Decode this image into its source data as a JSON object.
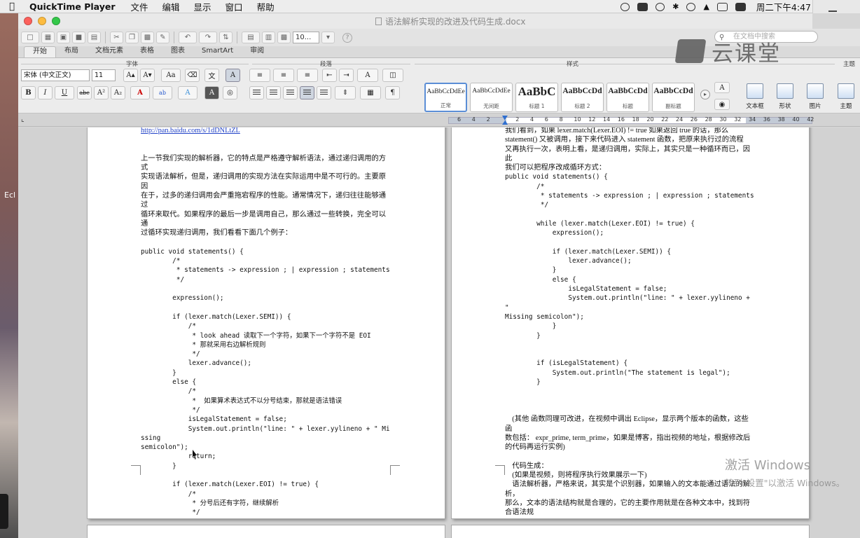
{
  "menubar": {
    "app": "QuickTime Player",
    "items": [
      "文件",
      "编辑",
      "显示",
      "窗口",
      "帮助"
    ],
    "clock": "周二下午4:47"
  },
  "window": {
    "title": "语法解析实现的改进及代码生成.docx",
    "zoom": "10...",
    "search_placeholder": "在文档中搜索"
  },
  "tabs": [
    "开始",
    "布局",
    "文档元素",
    "表格",
    "图表",
    "SmartArt",
    "审阅"
  ],
  "ribbon": {
    "groups": {
      "font": "字体",
      "paragraph": "段落",
      "styles": "样式",
      "theme": "主题"
    },
    "font_name": "宋体 (中文正文)",
    "font_size": "11",
    "styles": [
      {
        "preview": "AaBbCcDdEe",
        "name": "正常"
      },
      {
        "preview": "AaBbCcDdEe",
        "name": "无间距"
      },
      {
        "preview": "AaBbC",
        "name": "标题 1"
      },
      {
        "preview": "AaBbCcDd",
        "name": "标题 2"
      },
      {
        "preview": "AaBbCcDd",
        "name": "标题"
      },
      {
        "preview": "AaBbCcDd",
        "name": "副标题"
      }
    ],
    "buttons": {
      "textbox": "文本框",
      "shape": "形状",
      "picture": "图片",
      "theme": "主题"
    }
  },
  "ruler": {
    "numbers": [
      "6",
      "4",
      "2",
      "",
      "2",
      "4",
      "6",
      "8",
      "10",
      "12",
      "14",
      "16",
      "18",
      "20",
      "22",
      "24",
      "26",
      "28",
      "30",
      "32",
      "34",
      "36",
      "38",
      "40",
      "42"
    ]
  },
  "overlay": {
    "logo_text": "云课堂"
  },
  "watermark": {
    "line1": "激活 Windows",
    "line2": "转到\"设置\"以激活 Windows。"
  },
  "desktop": {
    "label": "Ecl"
  },
  "page1": {
    "lines": [
      "http://pan.baidu.com/s/1dDNLtZL",
      "",
      "",
      "上一节我们实现的解析器，它的特点是严格遵守解析语法，通过递归调用的方式",
      "实现语法解析，但是，递归调用的实现方法在实际运用中是不可行的。主要原因",
      "在于，过多的递归调用会严重拖宕程序的性能。通常情况下，递归往往能够通过",
      "循环来取代。如果程序的最后一步是调用自己，那么通过一些转换，完全可以通",
      "过循环实现递归调用，我们看看下面几个例子：",
      "",
      "public void statements() {",
      "        /*",
      "         * statements -> expression ; | expression ; statements",
      "         */",
      "",
      "        expression();",
      "",
      "        if (lexer.match(Lexer.SEMI)) {",
      "            /*",
      "             * look ahead 读取下一个字符，如果下一个字符不是 EOI",
      "             * 那就采用右边解析规则",
      "             */",
      "            lexer.advance();",
      "        }",
      "        else {",
      "            /*",
      "             *  如果算术表达式不以分号结束，那就是语法错误",
      "             */",
      "            isLegalStatement = false;",
      "            System.out.println(\"line: \" + lexer.yylineno + \" Missing",
      "semicolon\");",
      "            return;",
      "        }",
      "",
      "        if (lexer.match(Lexer.EOI) != true) {",
      "            /*",
      "             * 分号后还有字符，继续解析",
      "             */"
    ]
  },
  "page2": {
    "lines": [
      "我们看到，如果 lexer.match(Lexer.EOI) != true 如果返回 true 的话，那么",
      "statement() 又被调用，接下来代码进入 statement 函数，把原来执行过的流程",
      "又再执行一次，表明上看，是递归调用，实际上，其实只是一种循环而已，因此",
      "我们可以把程序改成循环方式：",
      "public void statements() {",
      "        /*",
      "         * statements -> expression ; | expression ; statements",
      "         */",
      "",
      "        while (lexer.match(Lexer.EOI) != true) {",
      "            expression();",
      "",
      "            if (lexer.match(Lexer.SEMI)) {",
      "                lexer.advance();",
      "            }",
      "            else {",
      "                isLegalStatement = false;",
      "                System.out.println(\"line: \" + lexer.yylineno + \"",
      "Missing semicolon\");",
      "            }",
      "        }",
      "",
      "",
      "        if (isLegalStatement) {",
      "            System.out.println(\"The statement is legal\");",
      "        }",
      "",
      "",
      "",
      "    (其他 函数同理可改进，在视频中调出 Eclipse，显示两个版本的函数，这些函",
      "数包括： expr_prime, term_prime，如果是博客，指出视频的地址，根据修改后",
      "的代码再运行实例)",
      "",
      "    代码生成：",
      "    (如果是视频，则将程序执行效果展示一下)",
      "    语法解析器，严格来说，其实是个识别器，如果输入的文本能通过语法的解析，",
      "那么，文本的语法结构就是合理的，它的主要作用就是在各种文本中，找到符合语法规"
    ]
  }
}
